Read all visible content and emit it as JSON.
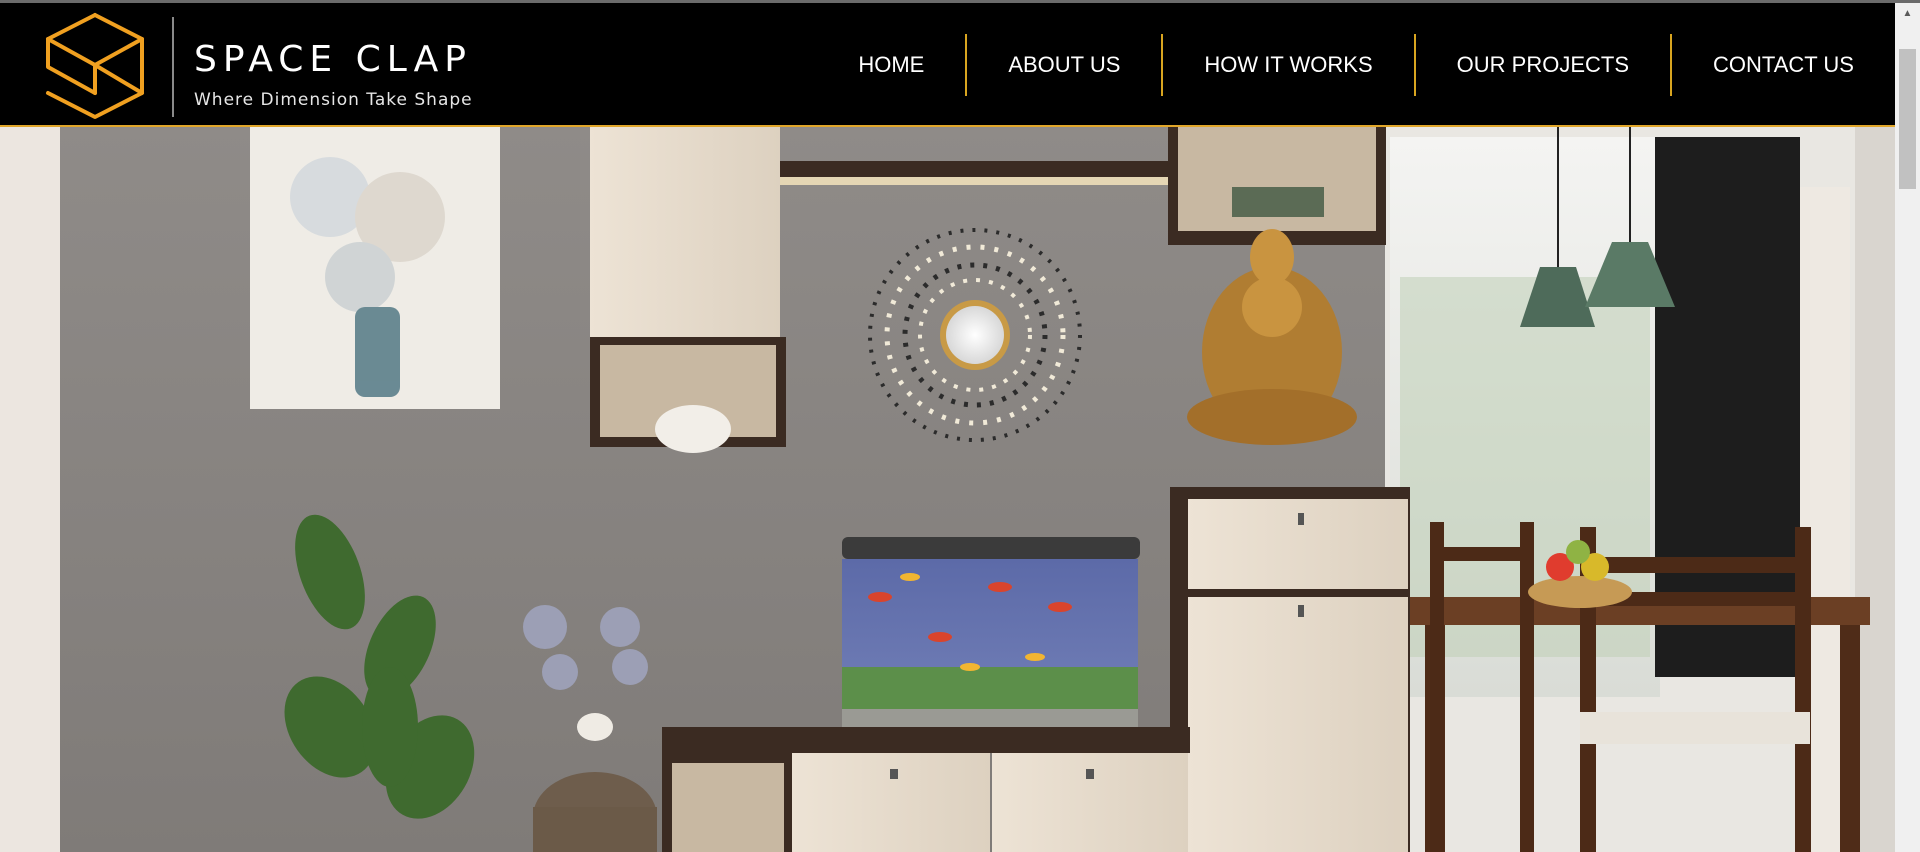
{
  "brand": {
    "name": "SPACE CLAP",
    "tagline": "Where Dimension Take Shape",
    "logo_icon": "cube-logo-icon",
    "accent_color": "#e0a62a"
  },
  "nav": {
    "items": [
      {
        "label": "HOME"
      },
      {
        "label": "ABOUT US"
      },
      {
        "label": "HOW IT WORKS"
      },
      {
        "label": "OUR PROJECTS"
      },
      {
        "label": "CONTACT US"
      }
    ],
    "separator_color": "#d9a520",
    "background": "#000000"
  },
  "hero": {
    "image_subject": "living-dining-interior-scene"
  },
  "scrollbar": {
    "up_icon": "scroll-up-arrow-icon"
  }
}
